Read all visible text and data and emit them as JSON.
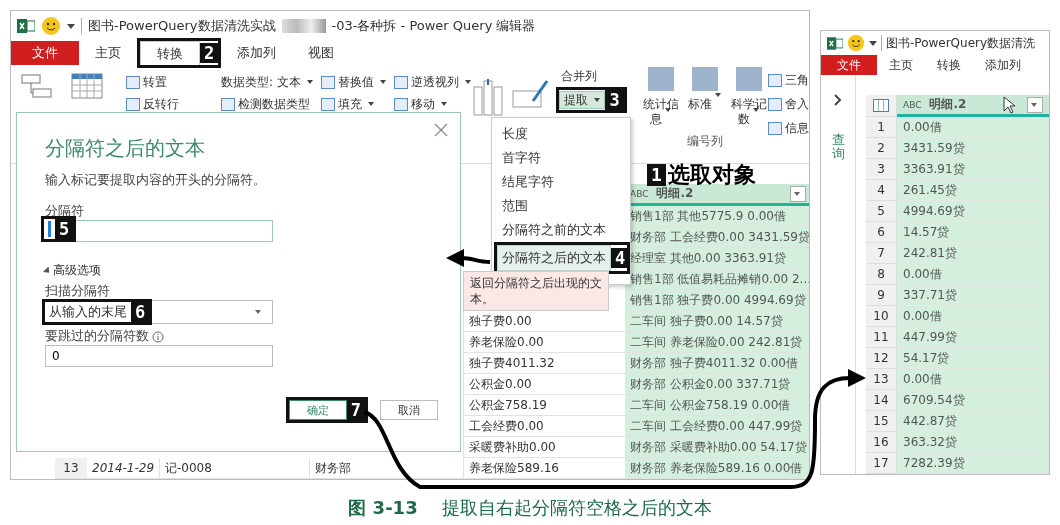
{
  "left_window": {
    "title_parts": [
      "图书-PowerQuery数据清洗实战",
      "-03-各种拆 - Power Query 编辑器"
    ],
    "tabs": [
      {
        "label": "文件",
        "kind": "file",
        "selected": false
      },
      {
        "label": "主页",
        "kind": "tab",
        "selected": false
      },
      {
        "label": "转换",
        "kind": "tab",
        "selected": true,
        "callout": "2"
      },
      {
        "label": "添加列",
        "kind": "tab",
        "selected": false
      },
      {
        "label": "视图",
        "kind": "tab",
        "selected": false
      }
    ],
    "ribbon": {
      "row_tools": [
        {
          "label": "转置"
        },
        {
          "label": "反转行"
        }
      ],
      "type_tools": [
        {
          "label": "数据类型: 文本",
          "dropdown": true
        },
        {
          "label": "替换值",
          "dropdown": true
        },
        {
          "label": "逆透视列",
          "dropdown": true
        },
        {
          "label": "检测数据类型",
          "dropdown": false
        },
        {
          "label": "填充",
          "dropdown": true
        },
        {
          "label": "移动",
          "dropdown": true
        }
      ],
      "text_tools": [
        {
          "label": "合并列",
          "pressed": false
        },
        {
          "label": "提取",
          "dropdown": true,
          "pressed": true,
          "callout": "3"
        }
      ],
      "number_tools": [
        {
          "label": "统计信息",
          "dropdown": true
        },
        {
          "label": "标准",
          "dropdown": true
        },
        {
          "label": "科学记数",
          "dropdown": true
        }
      ],
      "small_tools": [
        {
          "label": "三角"
        },
        {
          "label": "舍入"
        },
        {
          "label": "信息"
        }
      ],
      "group_label": "编号列"
    },
    "column": {
      "type_label": "ABC",
      "label": "明细.2",
      "selected": true
    },
    "rows": [
      {
        "detail2": "销售1部 其他5775.9 0.00借"
      },
      {
        "detail2": "财务部 工会经费0.00 3431.59贷"
      },
      {
        "detail2": "经理室 其他0.00 3363.91贷"
      },
      {
        "detail2": "销售1部 低值易耗品摊销0.00 2..."
      },
      {
        "detail2": "销售1部 独子费0.00 4994.69贷"
      },
      {
        "detail1": "独子费0.00",
        "detail2": "二车间 独子费0.00 14.57贷"
      },
      {
        "detail1": "养老保险0.00",
        "detail2": "二车间 养老保险0.00 242.81贷"
      },
      {
        "detail1": "独子费4011.32",
        "detail2": "财务部 独子费4011.32 0.00借"
      },
      {
        "detail1": "公积金0.00",
        "detail2": "财务部 公积金0.00 337.71贷"
      },
      {
        "detail1": "公积金758.19",
        "detail2": "二车间 公积金758.19 0.00借"
      },
      {
        "detail1": "工会经费0.00",
        "detail2": "二车间 工会经费0.00 447.99贷"
      },
      {
        "detail1": "采暖费补助0.00",
        "detail2": "财务部 采暖费补助0.00 54.17贷"
      },
      {
        "num": "13",
        "date": "2014-1-29",
        "voucher": "记-0008",
        "dept": "财务部",
        "detail1": "养老保险589.16",
        "detail2": "财务部 养老保险589.16 0.00借"
      }
    ],
    "dialog": {
      "title": "分隔符之后的文本",
      "description": "输入标记要提取内容的开头的分隔符。",
      "delimiter_label": "分隔符",
      "delimiter_callout": "5",
      "advanced_label": "高级选项",
      "advanced_expanded": true,
      "scan_label": "扫描分隔符",
      "scan_value": "从输入的末尾",
      "scan_callout": "6",
      "skip_label": "要跳过的分隔符数",
      "skip_value": "0",
      "ok": "确定",
      "ok_callout": "7",
      "cancel": "取消"
    },
    "menu": [
      {
        "label": "长度",
        "selected": false
      },
      {
        "label": "首字符",
        "selected": false
      },
      {
        "label": "结尾字符",
        "selected": false
      },
      {
        "label": "范围",
        "selected": false
      },
      {
        "label": "分隔符之前的文本",
        "selected": false
      },
      {
        "label": "分隔符之后的文本",
        "selected": true,
        "callout": "4"
      }
    ],
    "tooltip": "返回分隔符之后出现的文本。",
    "annotation": {
      "badge": "1",
      "text": "选取对象"
    }
  },
  "right_window": {
    "title": "图书-PowerQuery数据清洗",
    "tabs": [
      {
        "label": "文件",
        "kind": "file",
        "selected": false
      },
      {
        "label": "主页",
        "kind": "tab",
        "selected": false
      },
      {
        "label": "转换",
        "kind": "tab",
        "selected": false
      },
      {
        "label": "添加列",
        "kind": "tab",
        "selected": false
      }
    ],
    "nav_label": "查询",
    "column": {
      "type_label": "ABC",
      "label": "明细.2",
      "selected": true
    },
    "rows": [
      {
        "num": "1",
        "value": "0.00借"
      },
      {
        "num": "2",
        "value": "3431.59贷"
      },
      {
        "num": "3",
        "value": "3363.91贷"
      },
      {
        "num": "4",
        "value": "261.45贷"
      },
      {
        "num": "5",
        "value": "4994.69贷"
      },
      {
        "num": "6",
        "value": "14.57贷"
      },
      {
        "num": "7",
        "value": "242.81贷"
      },
      {
        "num": "8",
        "value": "0.00借"
      },
      {
        "num": "9",
        "value": "337.71贷"
      },
      {
        "num": "10",
        "value": "0.00借"
      },
      {
        "num": "11",
        "value": "447.99贷"
      },
      {
        "num": "12",
        "value": "54.17贷"
      },
      {
        "num": "13",
        "value": "0.00借"
      },
      {
        "num": "14",
        "value": "6709.54贷"
      },
      {
        "num": "15",
        "value": "442.87贷"
      },
      {
        "num": "16",
        "value": "363.32贷"
      },
      {
        "num": "17",
        "value": "7282.39贷"
      }
    ]
  },
  "caption": {
    "figure": "图 3-13",
    "text": "提取自右起分隔符空格之后的文本"
  }
}
